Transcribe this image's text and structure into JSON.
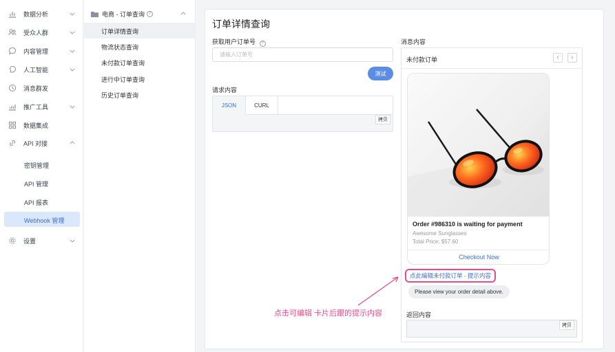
{
  "nav": {
    "items": [
      {
        "label": "数据分析",
        "icon": "bar-chart-icon"
      },
      {
        "label": "受众人群",
        "icon": "users-icon"
      },
      {
        "label": "内容管理",
        "icon": "chat-bubble-icon"
      },
      {
        "label": "人工智能",
        "icon": "brain-icon"
      },
      {
        "label": "消息群发",
        "icon": "clock-icon"
      },
      {
        "label": "推广工具",
        "icon": "chart-growth-icon"
      },
      {
        "label": "数据集成",
        "icon": "grid-icon"
      },
      {
        "label": "API 对接",
        "icon": "link-icon"
      }
    ],
    "api_sub": [
      "密钥管理",
      "API 管理",
      "API 报表"
    ],
    "active_sub": "Webhook 管理",
    "settings": "设置"
  },
  "col2": {
    "title": "电商 - 订单查询",
    "items": [
      "订单详情查询",
      "物流状态查询",
      "未付款订单查询",
      "进行中订单查询",
      "历史订单查询"
    ]
  },
  "main": {
    "title": "订单详情查询",
    "order_label": "获取用户订单号",
    "order_placeholder": "请输入订单号",
    "test_label": "测试",
    "request_label": "请求内容",
    "tab_json": "JSON",
    "tab_curl": "CURL",
    "copy_label": "拷贝",
    "message_label": "消息内容"
  },
  "preview": {
    "title": "未付款订单",
    "card_title": "Order #986310 is waiting for payment",
    "card_subtitle": "Awesome Sunglasses",
    "card_price": "Total Price: $57.60",
    "card_button": "Checkout Now",
    "edit_link": "点此编辑未付款订单 - 提示内容",
    "reply_text": "Please view your order detail above.",
    "return_label": "返回内容",
    "return_copy": "拷贝"
  },
  "annotation": "点击可编辑 卡片后跟的提示内容",
  "colors": {
    "accent": "#3d6fd6",
    "button": "#5b8de6",
    "highlight": "#e84b8a",
    "active_bg": "#dbe7fb"
  }
}
